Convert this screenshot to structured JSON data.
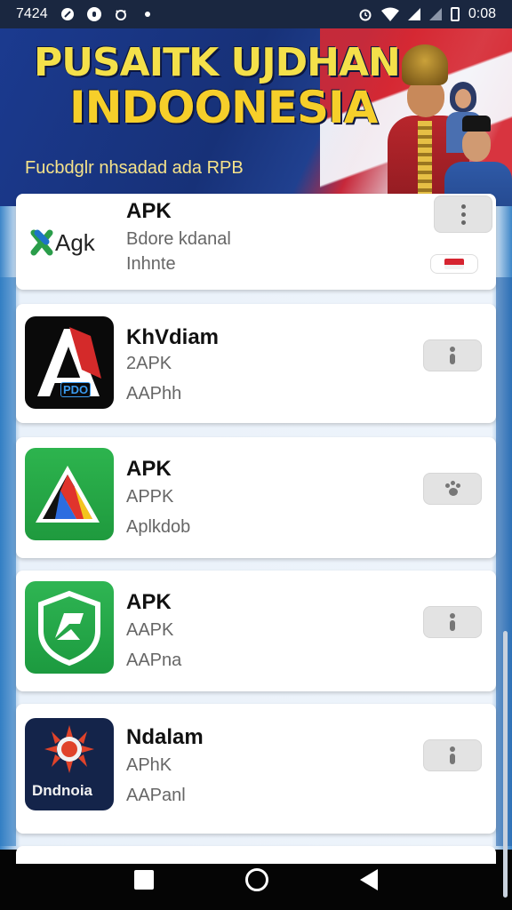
{
  "status_bar": {
    "time": "7424",
    "right_time": "0:08",
    "icons": [
      "tiktok-icon",
      "notification-icon",
      "cat-icon",
      "dot-icon",
      "alarm-icon",
      "wifi-icon",
      "signal-icon",
      "battery-icon"
    ]
  },
  "banner": {
    "title_line1": "PUSAITK UJDHAN",
    "title_line2": "INDOONESIA",
    "subtitle": "Fucbdglr nhsadad ada RPB"
  },
  "apps": [
    {
      "icon_text": "Agk",
      "name": "APK",
      "line2": "Bdore kdanal",
      "line3": "Inhnte",
      "action": "menu-icon"
    },
    {
      "icon_text": "PDO",
      "name": "KhVdiam",
      "line2": "2APK",
      "line3": "AAPhh",
      "action": "info-icon"
    },
    {
      "icon_text": "",
      "name": "APK",
      "line2": "APPK",
      "line3": "Aplkdob",
      "action": "paw-icon"
    },
    {
      "icon_text": "",
      "name": "APK",
      "line2": "AAPK",
      "line3": "AAPna",
      "action": "info-icon"
    },
    {
      "icon_text": "Dndnoia",
      "name": "Ndalam",
      "line2": "APhK",
      "line3": "AAPanl",
      "action": "info-icon"
    }
  ],
  "colors": {
    "banner_title": "#f4e04a",
    "banner_subtitle": "#f6e38a",
    "card_bg": "#ffffff",
    "nav_bg": "#050505"
  }
}
